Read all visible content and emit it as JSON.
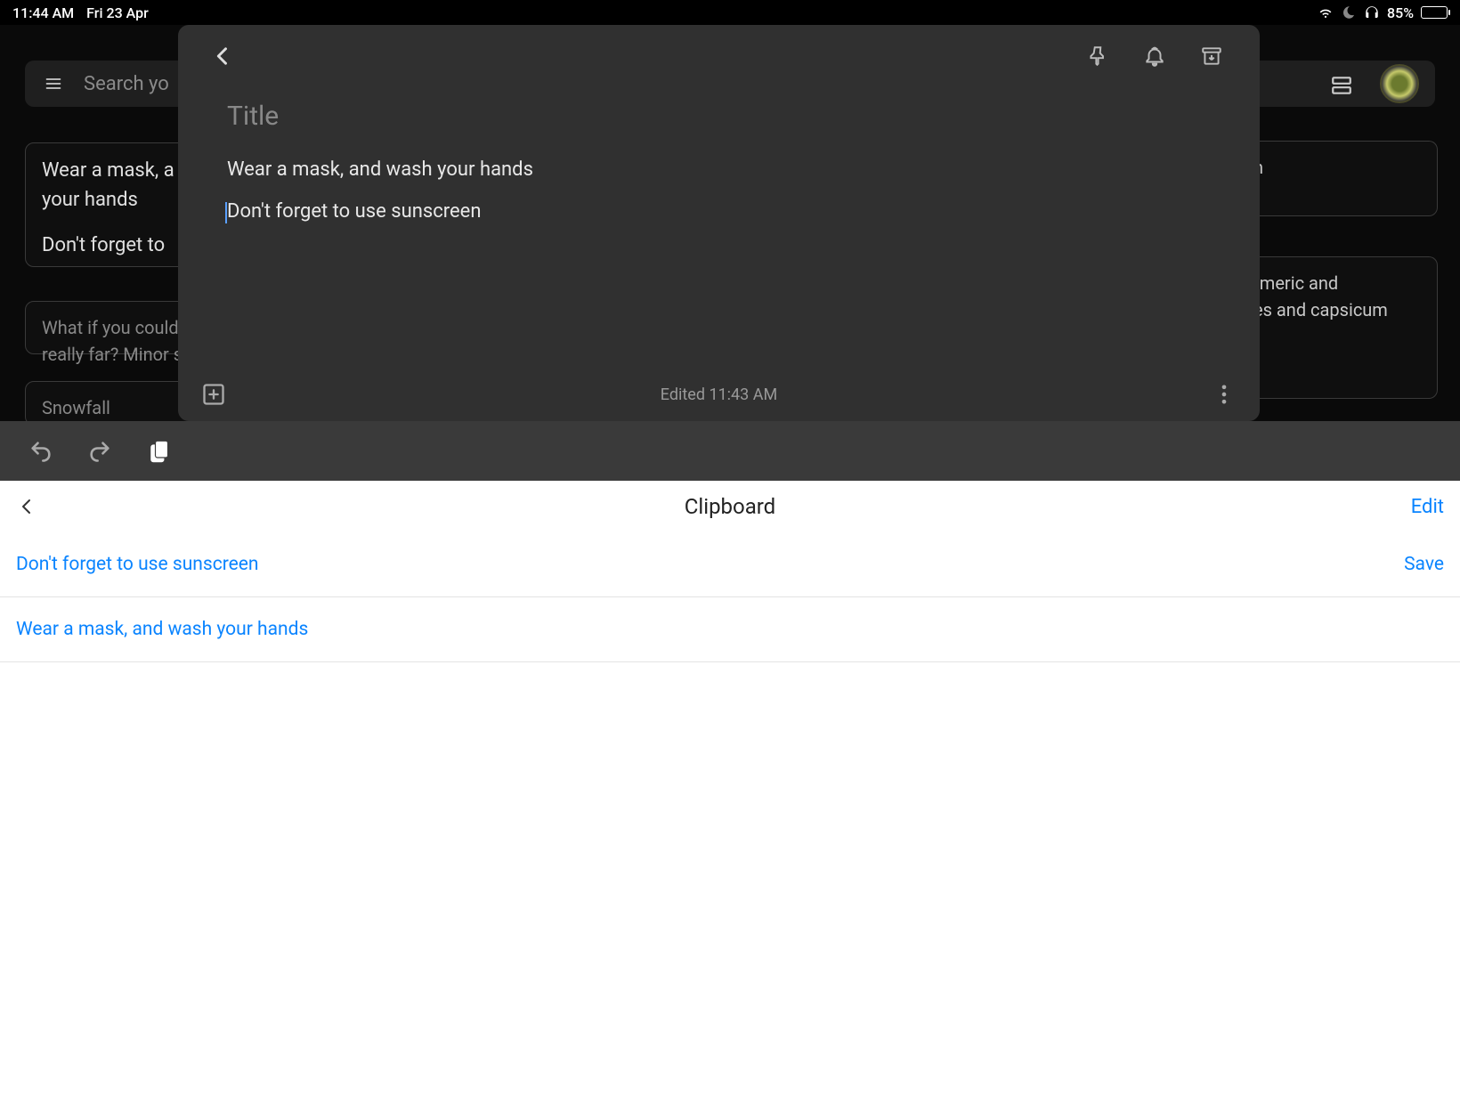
{
  "status_bar": {
    "time": "11:44 AM",
    "date": "Fri 23 Apr",
    "battery_pct": "85%"
  },
  "app_bg": {
    "search_placeholder": "Search yo",
    "cards": {
      "c1_line1": "Wear a mask, a",
      "c1_line2": "your hands",
      "c1_line3": "Don't forget to",
      "c3": "What if you could",
      "c3b": "really far? Minor s",
      "c4": "Snowfall",
      "c2_line1": "rmeric and",
      "c2_line2": "es and capsicum",
      "c5_text": "n"
    }
  },
  "note": {
    "title_placeholder": "Title",
    "body": {
      "line1": "Wear a mask, and wash your hands",
      "line2": "Don't forget to use sunscreen"
    },
    "edited_label": "Edited 11:43 AM"
  },
  "clipboard": {
    "title": "Clipboard",
    "edit_label": "Edit",
    "save_label": "Save",
    "items": [
      {
        "text": "Don't forget to use sunscreen"
      },
      {
        "text": "Wear a mask, and wash your hands"
      }
    ]
  }
}
